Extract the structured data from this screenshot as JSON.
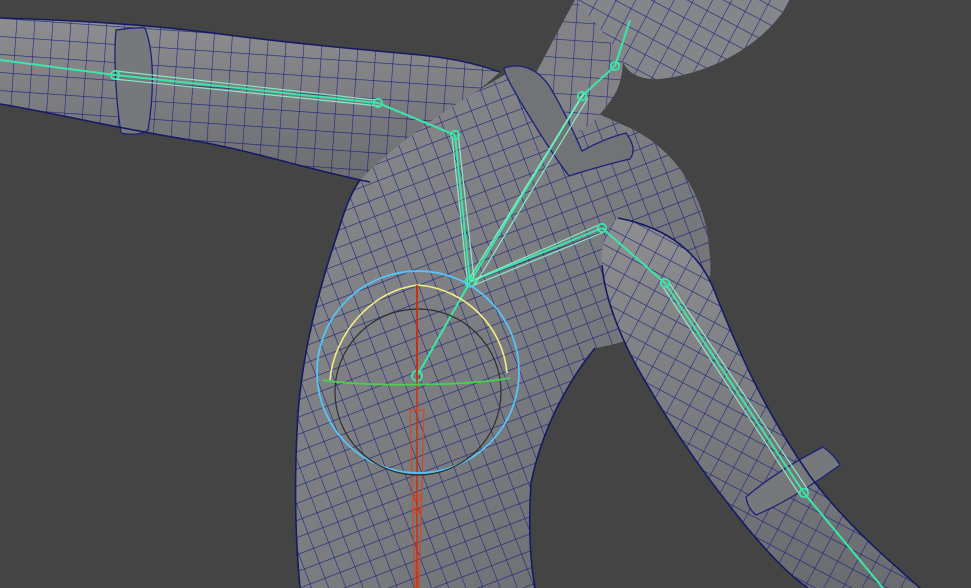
{
  "colors": {
    "viewport_background": "#444444",
    "mesh_fill": "#7f7f82",
    "mesh_fill_dark": "#5d5e63",
    "wireframe": "#151b63",
    "wireframe_light": "#26306f",
    "skeleton_joint": "#39e7a8",
    "skeleton_joint_light": "#8bf5cd",
    "root_joint_red": "#cc2d15",
    "rotate_gizmo_blue": "#51c8ff",
    "rotate_gizmo_yellow": "#f4ec83",
    "rotate_gizmo_green": "#4ad04d",
    "gizmo_shadow": "#2e2e2e"
  },
  "scene": {
    "subject": "rigged-character-torso-with-arms",
    "selected_joint": "spine-joint",
    "manipulator": "rotate-manipulator"
  }
}
